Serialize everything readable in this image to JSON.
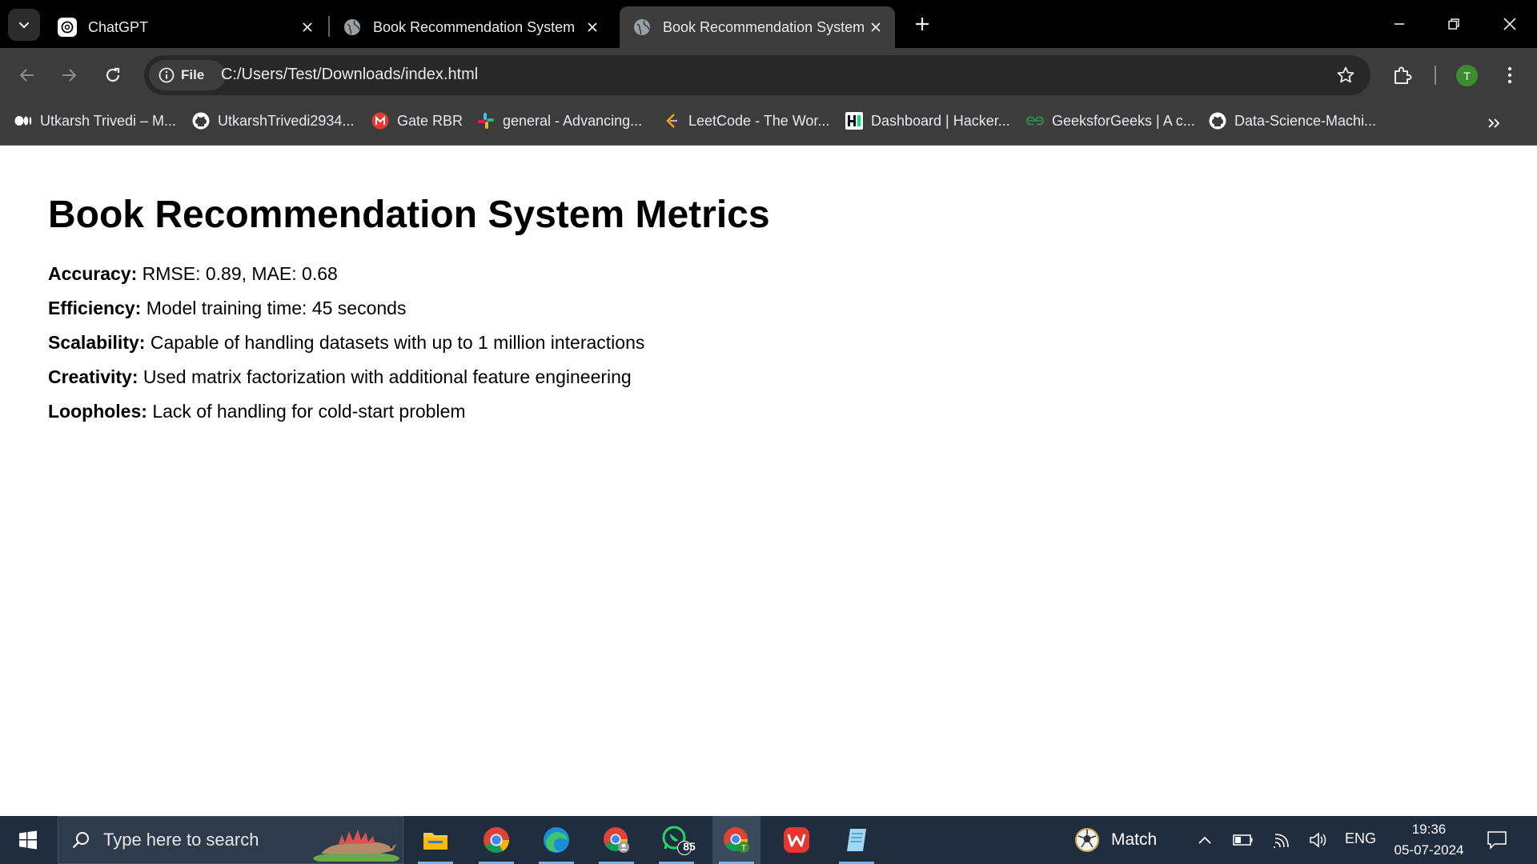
{
  "browser": {
    "tabs": [
      {
        "title": "ChatGPT",
        "favicon": "chatgpt-icon",
        "active": false
      },
      {
        "title": "Book Recommendation System",
        "favicon": "globe-icon",
        "active": false
      },
      {
        "title": "Book Recommendation System",
        "favicon": "globe-icon",
        "active": true
      }
    ],
    "site_chip": "File",
    "url": "C:/Users/Test/Downloads/index.html",
    "profile_initial": "T",
    "bookmarks": [
      {
        "label": "Utkarsh Trivedi – M...",
        "icon": "medium-icon"
      },
      {
        "label": "UtkarshTrivedi2934...",
        "icon": "github-icon"
      },
      {
        "label": "Gate RBR",
        "icon": "gate-icon"
      },
      {
        "label": "general - Advancing...",
        "icon": "slack-icon"
      },
      {
        "label": "LeetCode - The Wor...",
        "icon": "leetcode-icon"
      },
      {
        "label": "Dashboard | Hacker...",
        "icon": "hackerrank-icon"
      },
      {
        "label": "GeeksforGeeks | A c...",
        "icon": "geeksforgeeks-icon"
      },
      {
        "label": "Data-Science-Machi...",
        "icon": "github-icon"
      }
    ]
  },
  "page": {
    "heading": "Book Recommendation System Metrics",
    "metrics": [
      {
        "label": "Accuracy:",
        "value": "RMSE: 0.89, MAE: 0.68"
      },
      {
        "label": "Efficiency:",
        "value": "Model training time: 45 seconds"
      },
      {
        "label": "Scalability:",
        "value": "Capable of handling datasets with up to 1 million interactions"
      },
      {
        "label": "Creativity:",
        "value": "Used matrix factorization with additional feature engineering"
      },
      {
        "label": "Loopholes:",
        "value": "Lack of handling for cold-start problem"
      }
    ]
  },
  "taskbar": {
    "search_placeholder": "Type here to search",
    "apps": [
      "file-explorer-icon",
      "chrome-icon",
      "edge-icon",
      "chrome-profile-icon",
      "whatsapp-icon",
      "chrome-active-icon",
      "wps-office-icon",
      "notepad-icon"
    ],
    "whatsapp_badge": "85",
    "weather_label": "Match",
    "language": "ENG",
    "time": "19:36",
    "date": "05-07-2024"
  },
  "colors": {
    "tab_strip": "#000000",
    "toolbar": "#3c3c3c",
    "taskbar": "#1f2d3f",
    "profile": "#3c8d2f"
  }
}
